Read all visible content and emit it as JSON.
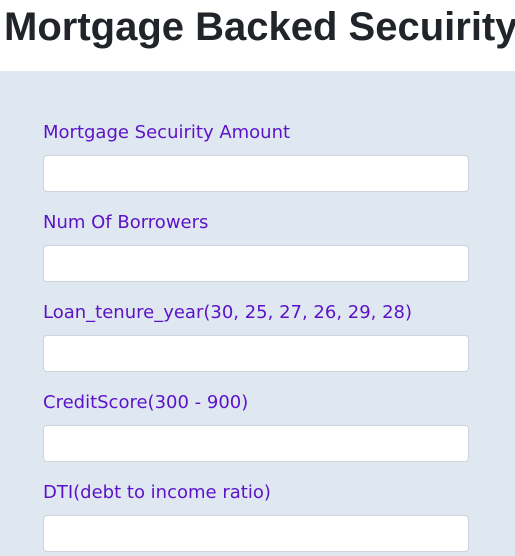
{
  "page": {
    "title": "Mortgage Backed Secuirity"
  },
  "form": {
    "fields": [
      {
        "label": "Mortgage Secuirity Amount",
        "value": "",
        "placeholder": ""
      },
      {
        "label": "Num Of Borrowers",
        "value": "",
        "placeholder": ""
      },
      {
        "label": "Loan_tenure_year(30, 25, 27, 26, 29, 28)",
        "value": "",
        "placeholder": ""
      },
      {
        "label": "CreditScore(300 - 900)",
        "value": "",
        "placeholder": ""
      },
      {
        "label": "DTI(debt to income ratio)",
        "value": "",
        "placeholder": ""
      }
    ]
  },
  "colors": {
    "title_text": "#212529",
    "label_text": "#5b12c8",
    "panel_background": "#dfe7f0",
    "input_background": "#ffffff",
    "input_border": "#cdd4dc"
  }
}
